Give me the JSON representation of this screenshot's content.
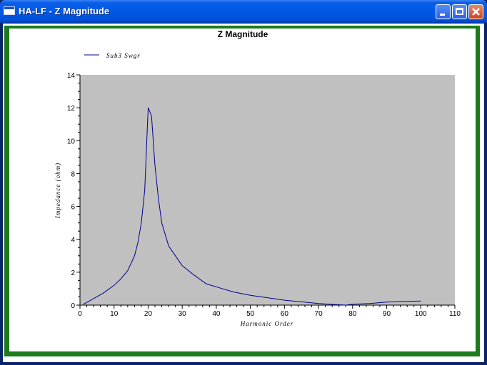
{
  "window": {
    "title": "HA-LF - Z Magnitude",
    "controls": [
      "minimize",
      "maximize",
      "close"
    ]
  },
  "chart_data": {
    "type": "line",
    "title": "Z Magnitude",
    "xlabel": "Harmonic Order",
    "ylabel": "Impedance (ohm)",
    "xlim": [
      0,
      110
    ],
    "ylim": [
      0,
      14
    ],
    "xticks": [
      0,
      10,
      20,
      30,
      40,
      50,
      60,
      70,
      80,
      90,
      100,
      110
    ],
    "yticks": [
      0,
      2,
      4,
      6,
      8,
      10,
      12,
      14
    ],
    "grid": false,
    "legend": "top-left",
    "plot_background": "#c0c0c0",
    "series": [
      {
        "name": "Sub3 Swgr",
        "color": "#00008b",
        "x": [
          1,
          4,
          7,
          10,
          12,
          14,
          16,
          17,
          18,
          19,
          20,
          21,
          22,
          23,
          24,
          25,
          26,
          28,
          30,
          33,
          37,
          41,
          45,
          50,
          55,
          60,
          65,
          70,
          75,
          78,
          80,
          85,
          90,
          95,
          100
        ],
        "y": [
          0.05,
          0.4,
          0.75,
          1.2,
          1.6,
          2.1,
          3.0,
          3.8,
          5.0,
          7.0,
          12.0,
          11.5,
          8.5,
          6.5,
          5.0,
          4.3,
          3.6,
          3.0,
          2.4,
          1.9,
          1.3,
          1.05,
          0.8,
          0.6,
          0.45,
          0.3,
          0.2,
          0.1,
          0.03,
          0.0,
          0.05,
          0.1,
          0.18,
          0.22,
          0.25
        ]
      }
    ]
  }
}
